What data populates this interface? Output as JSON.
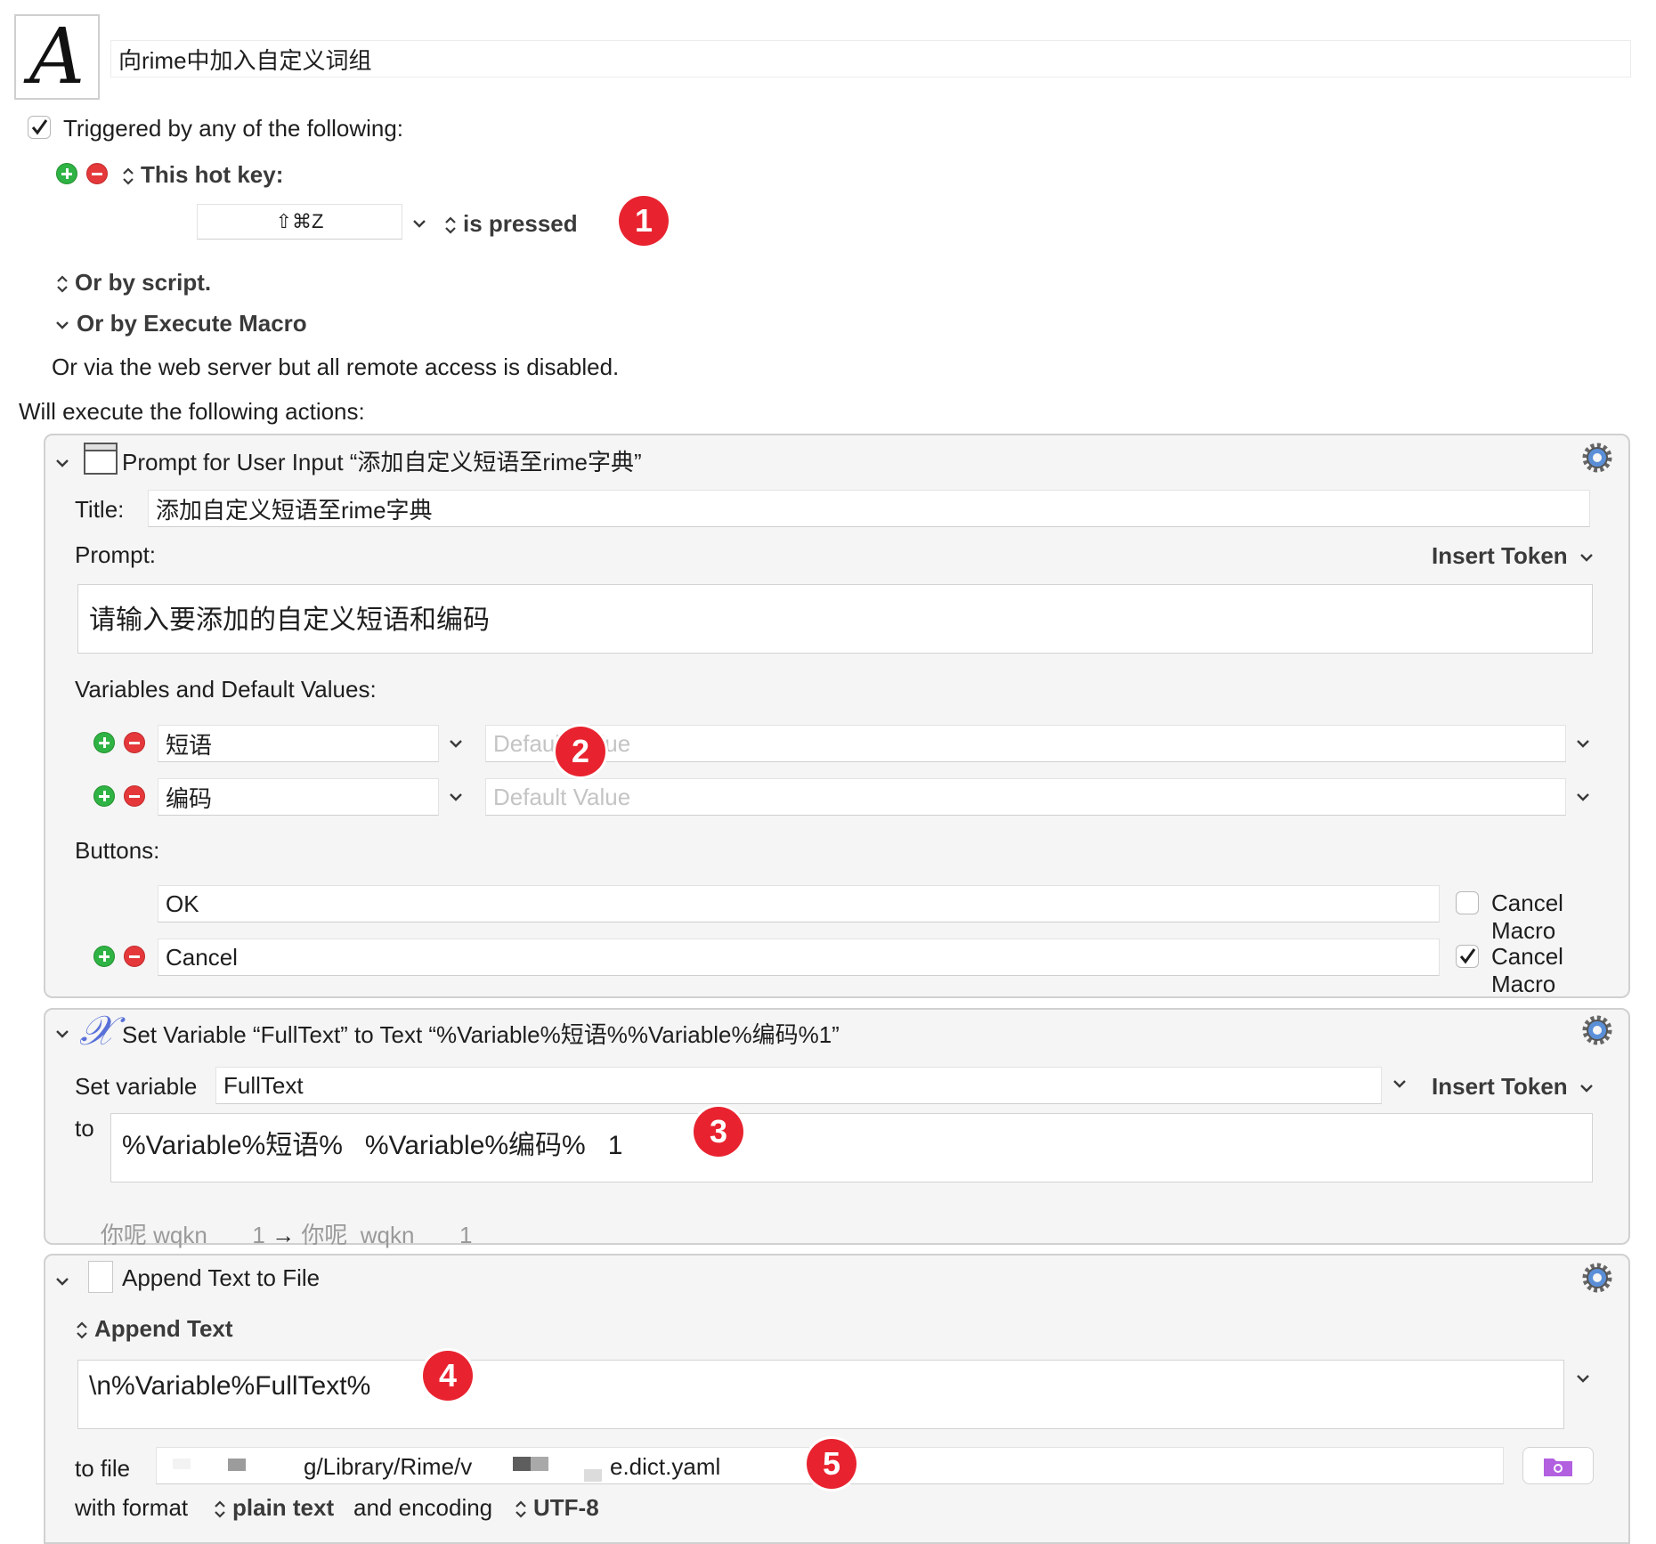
{
  "macro": {
    "title": "向rime中加入自定义词组",
    "icon": "A"
  },
  "trigger": {
    "enabled_label": "Triggered by any of the following:",
    "hotkey_label": "This hot key:",
    "hotkey_value": "⇧⌘Z",
    "pressed_label": "is pressed",
    "script_label": "Or by script.",
    "execute_label": "Or by Execute Macro",
    "web_server_label": "Or via the web server but all remote access is disabled."
  },
  "actions_label": "Will execute the following actions:",
  "prompt_action": {
    "header": "Prompt for User Input “添加自定义短语至rime字典”",
    "title_label": "Title:",
    "title_value": "添加自定义短语至rime字典",
    "prompt_label": "Prompt:",
    "insert_token": "Insert Token",
    "prompt_value": "请输入要添加的自定义短语和编码",
    "variables_label": "Variables and Default Values:",
    "variables": [
      {
        "name": "短语",
        "default_placeholder": "Default Value"
      },
      {
        "name": "编码",
        "default_placeholder": "Default Value"
      }
    ],
    "buttons_label": "Buttons:",
    "buttons": [
      {
        "label": "OK",
        "cancel_label": "Cancel Macro",
        "cancel_checked": false
      },
      {
        "label": "Cancel",
        "cancel_label": "Cancel Macro",
        "cancel_checked": true
      }
    ]
  },
  "set_variable_action": {
    "header": "Set Variable “FullText” to Text “%Variable%短语%%Variable%编码%1”",
    "set_label": "Set variable",
    "variable_name": "FullText",
    "insert_token": "Insert Token",
    "to_label": "to",
    "text_value": "%Variable%短语%   %Variable%编码%   1",
    "preview_left": "你呢 wqkn       1",
    "preview_arrow": "→",
    "preview_right": "你呢  wqkn       1"
  },
  "append_action": {
    "header": "Append Text to File",
    "mode_label": "Append Text",
    "text_value": "\\n%Variable%FullText%",
    "to_file_label": "to file",
    "file_path_mid": "g/Library/Rime/v",
    "file_path_end": "e.dict.yaml",
    "format_label": "with format",
    "format_value": "plain text",
    "encoding_label": "and encoding",
    "encoding_value": "UTF-8"
  },
  "badges": [
    "1",
    "2",
    "3",
    "4",
    "5"
  ],
  "colors": {
    "badge": "#e8232f",
    "plus": "#2fb344",
    "minus": "#e5383b",
    "gear": "#5a8fd8",
    "folder": "#b25fe0"
  }
}
